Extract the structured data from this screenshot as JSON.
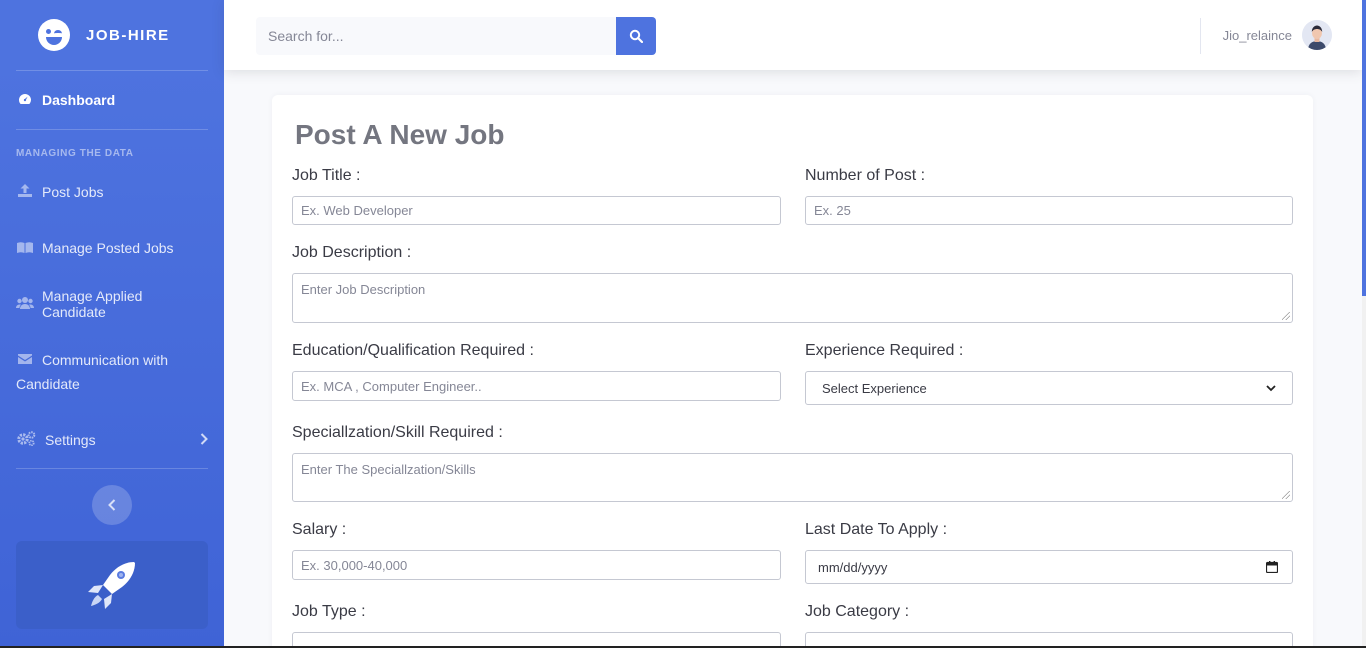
{
  "brand": {
    "name": "JOB-HIRE"
  },
  "sidebar": {
    "dashboard": "Dashboard",
    "heading": "MANAGING THE DATA",
    "items": [
      {
        "label": "Post Jobs",
        "icon": "upload-icon"
      },
      {
        "label": "Manage Posted Jobs",
        "icon": "book-icon"
      },
      {
        "label": "Manage Applied Candidate",
        "icon": "users-icon"
      },
      {
        "label_line1": "Communication with",
        "label_line2": "Candidate",
        "icon": "envelope-icon"
      },
      {
        "label": "Settings",
        "icon": "cogs-icon"
      }
    ]
  },
  "search": {
    "placeholder": "Search for..."
  },
  "user": {
    "name": "Jio_relaince"
  },
  "form": {
    "title": "Post A New Job",
    "job_title": {
      "label": "Job Title :",
      "placeholder": "Ex. Web Developer"
    },
    "num_post": {
      "label": "Number of Post :",
      "placeholder": "Ex. 25"
    },
    "description": {
      "label": "Job Description :",
      "placeholder": "Enter Job Description"
    },
    "education": {
      "label": "Education/Qualification Required :",
      "placeholder": "Ex. MCA , Computer Engineer.."
    },
    "experience": {
      "label": "Experience Required :",
      "selected": "Select Experience"
    },
    "skills": {
      "label": "Speciallzation/Skill Required :",
      "placeholder": "Enter The Speciallzation/Skills"
    },
    "salary": {
      "label": "Salary :",
      "placeholder": "Ex. 30,000-40,000"
    },
    "last_date": {
      "label": "Last Date To Apply :",
      "value": "mm/dd/yyyy"
    },
    "job_type": {
      "label": "Job Type :"
    },
    "job_category": {
      "label": "Job Category :"
    }
  },
  "colors": {
    "primary": "#4e73df",
    "sidebar_dark": "#3f63d6",
    "page_bg": "#f8f9fc"
  }
}
